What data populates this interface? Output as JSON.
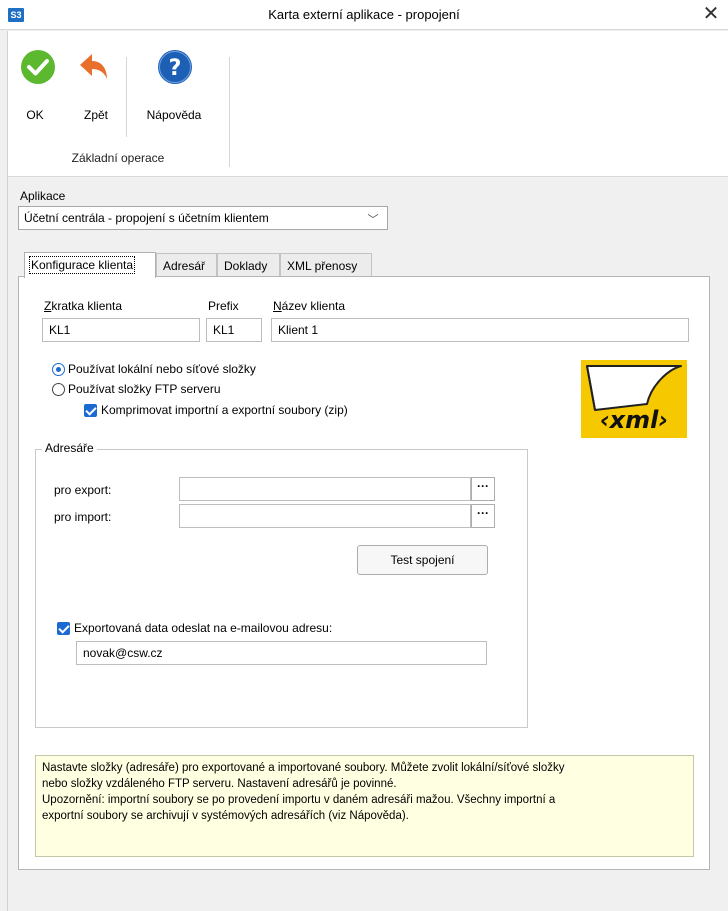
{
  "window": {
    "app_badge": "S3",
    "title": "Karta externí aplikace - propojení",
    "close_glyph": "✕"
  },
  "ribbon": {
    "ok_label": "OK",
    "back_label": "Zpět",
    "help_label": "Nápověda",
    "group_label": "Základní operace",
    "icons": {
      "ok": "check-circle-icon",
      "back": "back-arrow-icon",
      "help": "question-icon"
    },
    "colors": {
      "ok": "#5cb82e",
      "back": "#e8702a",
      "help": "#1e5fb6"
    }
  },
  "app_select": {
    "label": "Aplikace",
    "value": "Účetní centrála - propojení s účetním klientem",
    "arrow": "﹀"
  },
  "tabs": [
    {
      "label": "Konfigurace klienta",
      "active": true
    },
    {
      "label": "Adresář",
      "active": false
    },
    {
      "label": "Doklady",
      "active": false
    },
    {
      "label": "XML přenosy",
      "active": false
    }
  ],
  "client": {
    "shortcut_label": "Zkratka klienta",
    "shortcut_value": "KL1",
    "prefix_label": "Prefix",
    "prefix_value": "KL1",
    "name_label": "Název klienta",
    "name_value": "Klient 1"
  },
  "options": {
    "local_label": "Používat lokální nebo síťové složky",
    "local_selected": true,
    "ftp_label": "Používat složky FTP serveru",
    "ftp_selected": false,
    "zip_label": "Komprimovat importní a exportní soubory (zip)",
    "zip_checked": true
  },
  "xml_logo": "‹xml›",
  "directories": {
    "title": "Adresáře",
    "export_label": "pro export:",
    "export_value": "",
    "import_label": "pro import:",
    "import_value": "",
    "browse_label": "···",
    "test_button": "Test spojení",
    "email_checkbox_label": "Exportovaná data odeslat na e-mailovou adresu:",
    "email_checked": true,
    "email_value": "novak@csw.cz"
  },
  "info": [
    "Nastavte složky (adresáře) pro exportované a importované soubory. Můžete zvolit lokální/síťové složky",
    "nebo složky vzdáleného FTP serveru. Nastavení adresářů je povinné.",
    "Upozornění: importní soubory se po provedení importu v daném adresáři mažou. Všechny importní a",
    "exportní soubory se archivují v systémových adresářích (viz Nápověda)."
  ]
}
